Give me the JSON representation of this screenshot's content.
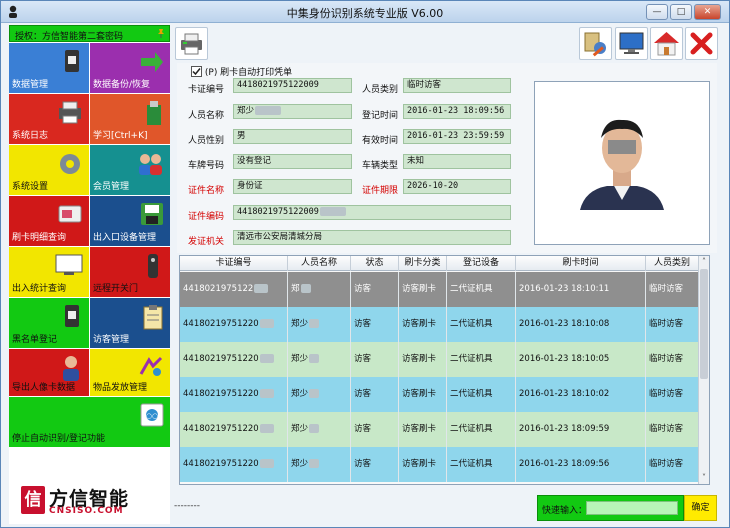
{
  "window": {
    "title": "中集身份识别系统专业版 V6.00",
    "minimize": "—",
    "maximize": "□",
    "close": "✕"
  },
  "left_panel": {
    "auth_text": "授权：方信智能第二套密码",
    "tiles": [
      {
        "label": "数据管理",
        "color": "#3a7fd5",
        "text_color": "#ffffff",
        "icon": "usb-drive-icon"
      },
      {
        "label": "数据备份/恢复",
        "color": "#9b2fae",
        "text_color": "#ffffff",
        "icon": "backup-arrow-icon"
      },
      {
        "label": "系统日志",
        "color": "#d9281f",
        "text_color": "#ffffff",
        "icon": "printer-log-icon"
      },
      {
        "label": "学习[Ctrl+K]",
        "color": "#e0562a",
        "text_color": "#ffffff",
        "icon": "learning-icon"
      },
      {
        "label": "系统设置",
        "color": "#f2e600",
        "text_color": "#111111",
        "icon": "gear-icon"
      },
      {
        "label": "会员管理",
        "color": "#159090",
        "text_color": "#ffffff",
        "icon": "members-icon"
      },
      {
        "label": "刷卡明细查询",
        "color": "#d01818",
        "text_color": "#ffffff",
        "icon": "card-query-icon"
      },
      {
        "label": "出入口设备管理",
        "color": "#1b4f8e",
        "text_color": "#ffffff",
        "icon": "save-device-icon"
      },
      {
        "label": "出入统计查询",
        "color": "#f2e600",
        "text_color": "#111111",
        "icon": "monitor-stats-icon"
      },
      {
        "label": "远程开关门",
        "color": "#d01818",
        "text_color": "#111111",
        "icon": "remote-control-icon"
      },
      {
        "label": "黑名单登记",
        "color": "#12c912",
        "text_color": "#111111",
        "icon": "usb-drive-icon"
      },
      {
        "label": "访客管理",
        "color": "#1b4f8e",
        "text_color": "#ffffff",
        "icon": "clipboard-icon"
      },
      {
        "label": "导出人像卡数据",
        "color": "#d01818",
        "text_color": "#111111",
        "icon": "person-export-icon"
      },
      {
        "label": "物品发放管理",
        "color": "#f2e600",
        "text_color": "#111111",
        "icon": "items-icon"
      },
      {
        "label": "停止自动识别/登记功能",
        "color": "#12c912",
        "text_color": "#111111",
        "icon": "stop-recognition-icon"
      }
    ],
    "logo_mark": "信",
    "logo_cn": "方信智能",
    "logo_en": "CNSISO.COM"
  },
  "toolbar": {
    "print_icon": "printer-icon",
    "right_icons": [
      "settings-tools-icon",
      "monitor-icon",
      "home-icon",
      "exit-x-icon"
    ]
  },
  "form": {
    "auto_print_label": "(P) 刷卡自动打印凭单",
    "auto_print_checked": true,
    "card_no_label": "卡证编号",
    "card_no_value": "4418021975122009",
    "person_type_label": "人员类别",
    "person_type_value": "临时访客",
    "name_label": "人员名称",
    "name_value": "郑少",
    "reg_time_label": "登记时间",
    "reg_time_value": "2016-01-23 18:09:56",
    "gender_label": "人员性别",
    "gender_value": "男",
    "valid_time_label": "有效时间",
    "valid_time_value": "2016-01-23 23:59:59",
    "plate_label": "车牌号码",
    "plate_value": "没有登记",
    "vehicle_type_label": "车辆类型",
    "vehicle_type_value": "未知",
    "id_name_label": "证件名称",
    "id_name_value": "身份证",
    "id_expiry_label": "证件期限",
    "id_expiry_value": "2026-10-20",
    "id_no_label": "证件编码",
    "id_no_value": "4418021975122009",
    "issuer_label": "发证机关",
    "issuer_value": "清远市公安局清城分局"
  },
  "grid": {
    "columns": [
      "卡证编号",
      "人员名称",
      "状态",
      "刷卡分类",
      "登记设备",
      "刷卡时间",
      "人员类别"
    ],
    "rows": [
      {
        "card": "4418021975122",
        "name": "郑",
        "status": "访客",
        "cls": "访客刷卡",
        "device": "二代证机具",
        "time": "2016-01-23 18:10:11",
        "type": "临时访客"
      },
      {
        "card": "44180219751220",
        "name": "郑少",
        "status": "访客",
        "cls": "访客刷卡",
        "device": "二代证机具",
        "time": "2016-01-23 18:10:08",
        "type": "临时访客"
      },
      {
        "card": "44180219751220",
        "name": "郑少",
        "status": "访客",
        "cls": "访客刷卡",
        "device": "二代证机具",
        "time": "2016-01-23 18:10:05",
        "type": "临时访客"
      },
      {
        "card": "44180219751220",
        "name": "郑少",
        "status": "访客",
        "cls": "访客刷卡",
        "device": "二代证机具",
        "time": "2016-01-23 18:10:02",
        "type": "临时访客"
      },
      {
        "card": "44180219751220",
        "name": "郑少",
        "status": "访客",
        "cls": "访客刷卡",
        "device": "二代证机具",
        "time": "2016-01-23 18:09:59",
        "type": "临时访客"
      },
      {
        "card": "44180219751220",
        "name": "郑少",
        "status": "访客",
        "cls": "访客刷卡",
        "device": "二代证机具",
        "time": "2016-01-23 18:09:56",
        "type": "临时访客"
      }
    ],
    "row_colors": [
      "#8f8f8f",
      "#8fd6ec",
      "#c8e8c8",
      "#8fd6ec",
      "#c8e8c8",
      "#8fd6ec"
    ]
  },
  "bottom": {
    "status_dashes": "--------",
    "quick_input_label": "快速输入：",
    "quick_input_value": "",
    "ok_label": "确定"
  }
}
